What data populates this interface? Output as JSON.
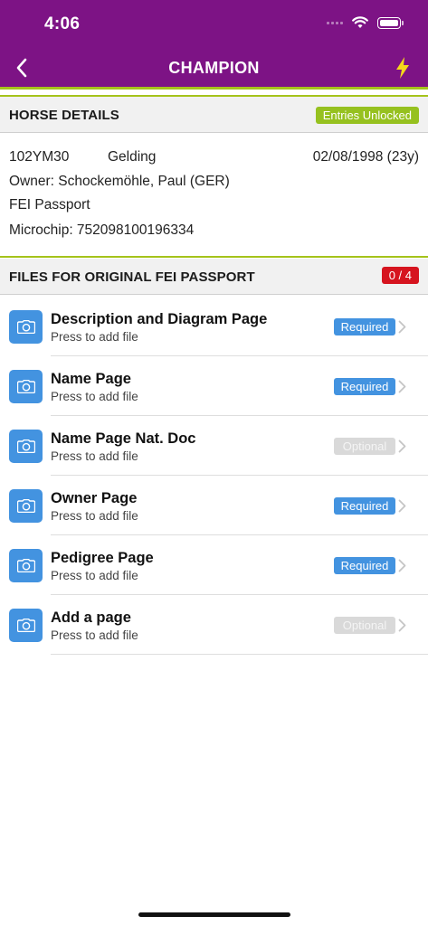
{
  "status_bar": {
    "time": "4:06"
  },
  "nav": {
    "title": "CHAMPION"
  },
  "colors": {
    "brand_purple": "#7d1385",
    "accent_green": "#a5c31b",
    "required_blue": "#4393e0",
    "alert_red": "#d6141f"
  },
  "horse_details": {
    "title": "HORSE DETAILS",
    "status_badge": "Entries Unlocked",
    "id": "102YM30",
    "sex": "Gelding",
    "dob": "02/08/1998 (23y)",
    "owner": "Owner: Schockemöhle, Paul (GER)",
    "passport": "FEI Passport",
    "microchip": "Microchip: 752098100196334"
  },
  "files": {
    "title": "FILES FOR ORIGINAL FEI PASSPORT",
    "count_badge": "0 / 4",
    "items": [
      {
        "name": "Description and Diagram Page",
        "sub": "Press to add file",
        "tag": "Required",
        "icon": "camera-icon"
      },
      {
        "name": "Name Page",
        "sub": "Press to add file",
        "tag": "Required",
        "icon": "camera-icon"
      },
      {
        "name": "Name Page Nat. Doc",
        "sub": "Press to add file",
        "tag": "Optional",
        "icon": "camera-icon"
      },
      {
        "name": "Owner Page",
        "sub": "Press to add file",
        "tag": "Required",
        "icon": "camera-icon"
      },
      {
        "name": "Pedigree Page",
        "sub": "Press to add file",
        "tag": "Required",
        "icon": "camera-icon"
      },
      {
        "name": "Add a page",
        "sub": "Press to add file",
        "tag": "Optional",
        "icon": "camera-icon"
      }
    ]
  }
}
